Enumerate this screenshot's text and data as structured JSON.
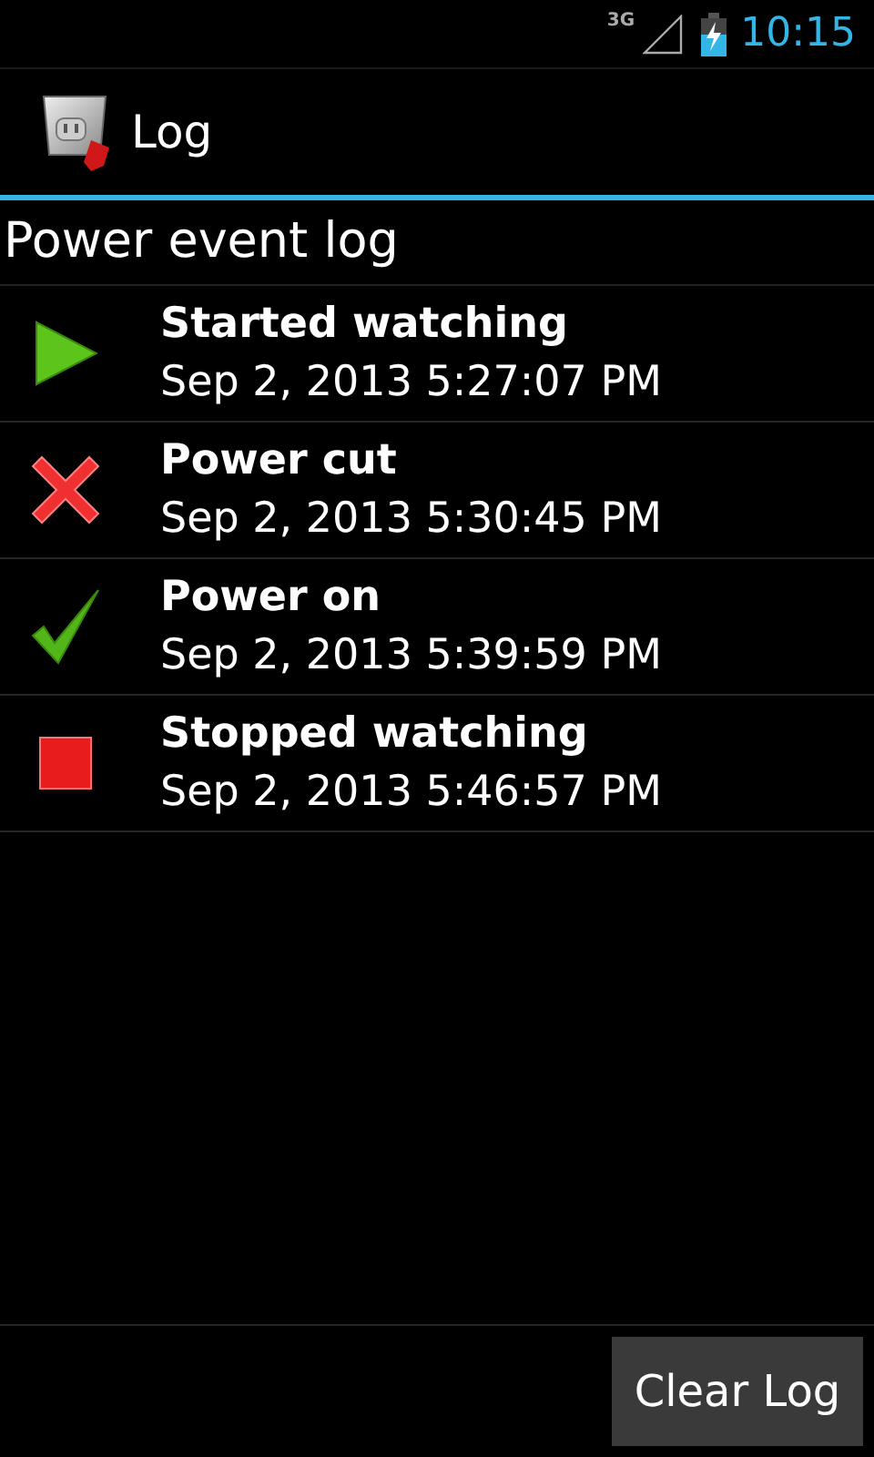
{
  "status_bar": {
    "network": "3G",
    "time": "10:15"
  },
  "action_bar": {
    "title": "Log"
  },
  "heading": "Power event log",
  "events": [
    {
      "kind": "start",
      "title": "Started watching",
      "time": "Sep 2, 2013 5:27:07 PM"
    },
    {
      "kind": "cut",
      "title": "Power cut",
      "time": "Sep 2, 2013 5:30:45 PM"
    },
    {
      "kind": "on",
      "title": "Power on",
      "time": "Sep 2, 2013 5:39:59 PM"
    },
    {
      "kind": "stop",
      "title": "Stopped watching",
      "time": "Sep 2, 2013 5:46:57 PM"
    }
  ],
  "buttons": [
    "Clear Log"
  ]
}
